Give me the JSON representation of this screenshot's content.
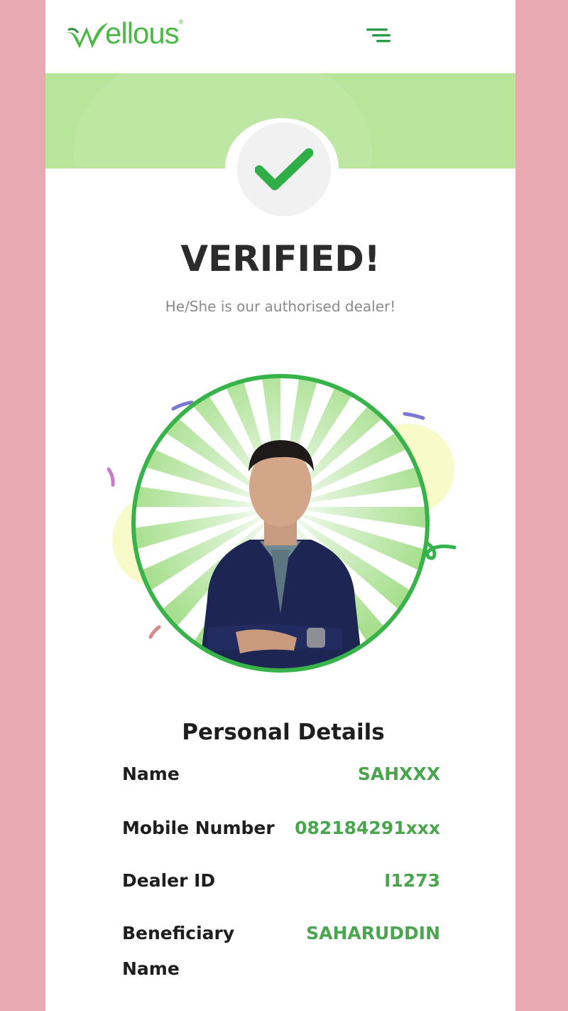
{
  "header": {
    "logo_text": "ellous",
    "logo_reg": "®",
    "logo_icon": "wellous-w-logo-icon",
    "menu_icon": "hamburger-menu-icon"
  },
  "status": {
    "icon": "checkmark-icon",
    "title": "VERIFIED!",
    "subtitle": "He/She is our authorised dealer!"
  },
  "profile": {
    "photo": "dealer-portrait-photo"
  },
  "personal_details": {
    "title": "Personal Details",
    "rows": [
      {
        "label": "Name",
        "value": "SAHXXX"
      },
      {
        "label": "Mobile Number",
        "value": "082184291xxx"
      },
      {
        "label": "Dealer ID",
        "value": "I1273"
      },
      {
        "label": "Beneficiary Name",
        "value": "SAHARUDDIN"
      }
    ]
  },
  "colors": {
    "page_background": "#e8a9b0",
    "brand_green": "#4cb848",
    "banner_green": "#b7e59a",
    "value_green": "#4aa54f"
  }
}
